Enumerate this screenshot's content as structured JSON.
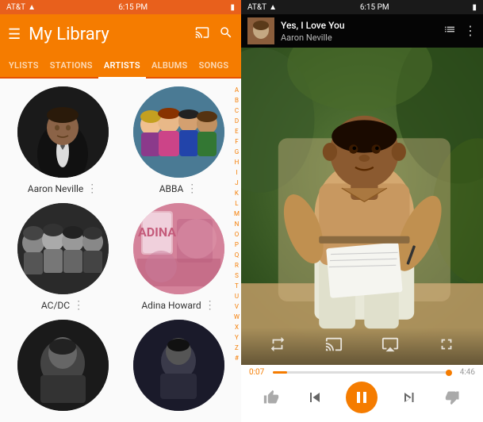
{
  "left": {
    "status_bar": {
      "carrier": "AT&T",
      "time": "6:15 PM",
      "battery": "100",
      "signal": "●●●●●"
    },
    "header": {
      "title": "My Library",
      "menu_icon": "☰",
      "cast_icon": "⊡",
      "search_icon": "🔍"
    },
    "tabs": [
      {
        "label": "YLISTS",
        "active": false
      },
      {
        "label": "STATIONS",
        "active": false
      },
      {
        "label": "ARTISTS",
        "active": true
      },
      {
        "label": "ALBUMS",
        "active": false
      },
      {
        "label": "SONGS",
        "active": false
      }
    ],
    "artists": [
      {
        "name": "Aaron Neville",
        "style": "aaron"
      },
      {
        "name": "ABBA",
        "style": "abba"
      },
      {
        "name": "AC/DC",
        "style": "acdc"
      },
      {
        "name": "Adina Howard",
        "style": "adina"
      },
      {
        "name": "",
        "style": "bottom1"
      },
      {
        "name": "",
        "style": "bottom2"
      }
    ],
    "alphabet": [
      "A",
      "B",
      "C",
      "D",
      "E",
      "F",
      "G",
      "H",
      "I",
      "J",
      "K",
      "L",
      "M",
      "N",
      "O",
      "P",
      "Q",
      "R",
      "S",
      "T",
      "U",
      "V",
      "W",
      "X",
      "Y",
      "Z",
      "#"
    ]
  },
  "right": {
    "status_bar": {
      "carrier": "AT&T",
      "time": "6:15 PM"
    },
    "now_playing": {
      "song_title": "Yes, I Love You",
      "artist": "Aaron Neville",
      "queue_icon": "≡",
      "more_icon": "⋮"
    },
    "player": {
      "time_current": "0:07",
      "time_total": "4:46",
      "progress_pct": 8
    },
    "controls": {
      "thumbs_up": "👍",
      "prev": "⏮",
      "play_pause": "⏸",
      "next": "⏭",
      "thumbs_down": "👎"
    },
    "transport_overlay": {
      "loop_icon": "↺",
      "cast_icon": "⊡",
      "airplay_icon": "⬛",
      "fullscreen_icon": "⤢"
    }
  }
}
